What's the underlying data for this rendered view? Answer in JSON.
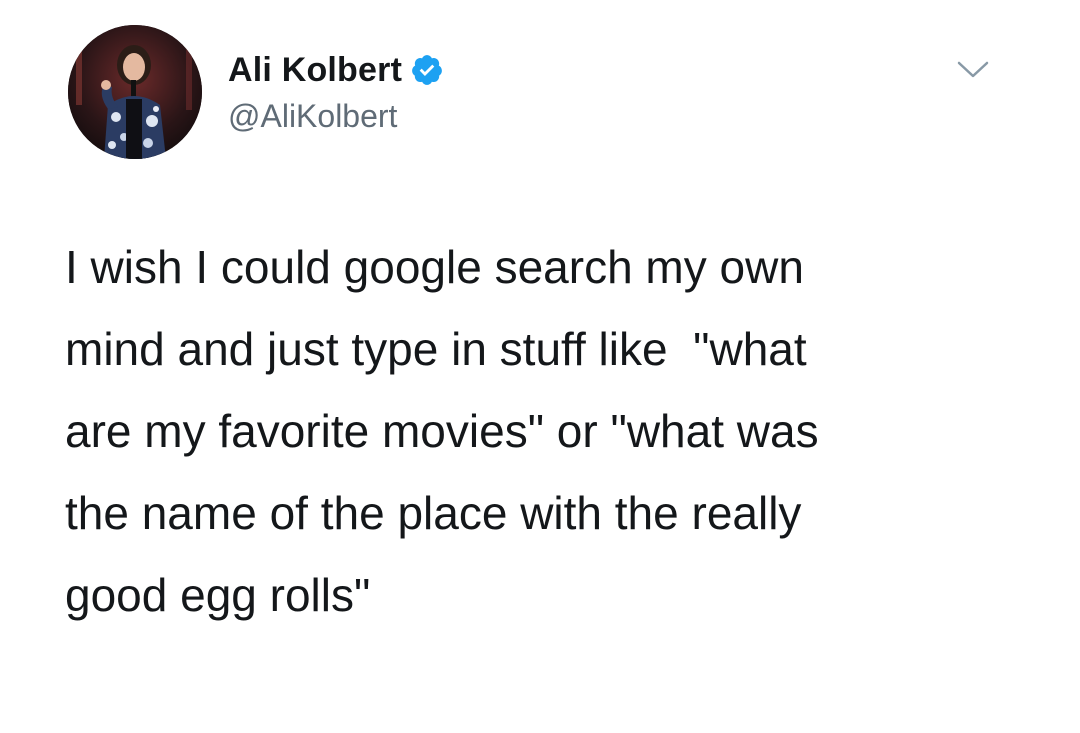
{
  "author": {
    "display_name": "Ali Kolbert",
    "handle": "@AliKolbert",
    "verified": true,
    "avatar_icon": "profile-photo-icon"
  },
  "menu": {
    "caret_icon": "chevron-down-icon"
  },
  "tweet": {
    "lines": [
      "I wish I could google search my own",
      "mind and just type in stuff like  \"what",
      "are my favorite movies\" or \"what was",
      "the name of the place with the really",
      "good egg rolls\""
    ]
  },
  "colors": {
    "verified_badge": "#1da1f2",
    "text": "#14171a",
    "secondary_text": "#5f6b76",
    "background": "#ffffff"
  }
}
